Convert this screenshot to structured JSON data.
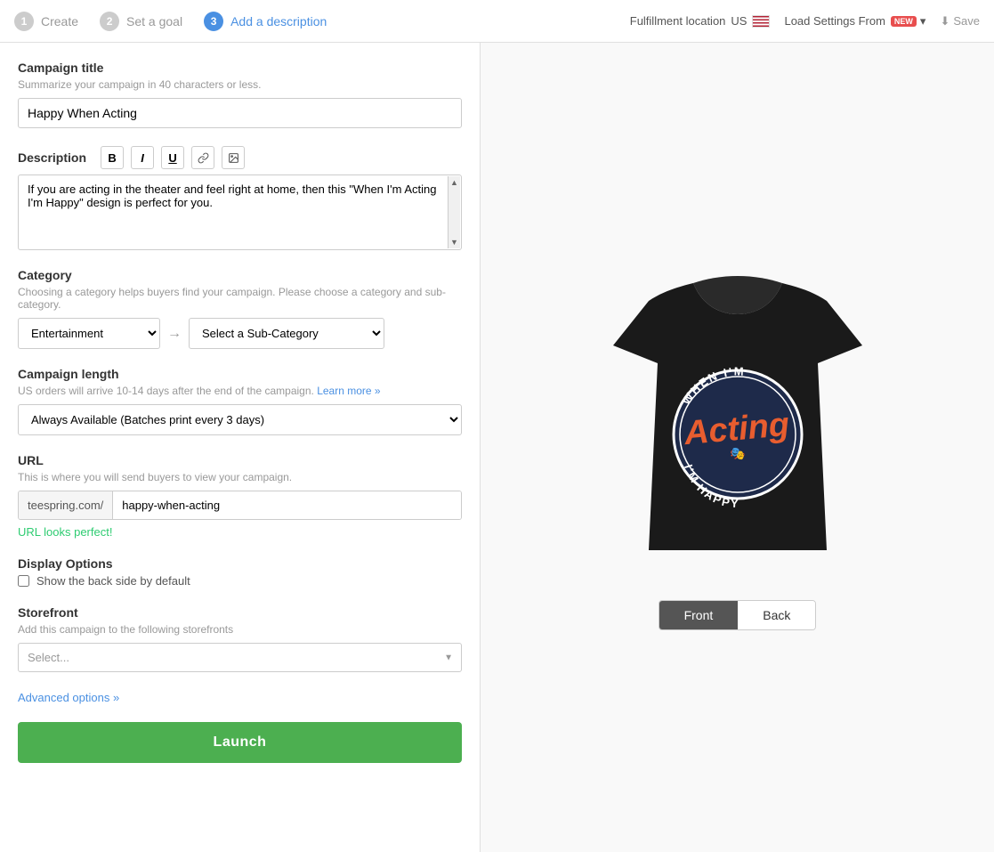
{
  "header": {
    "steps": [
      {
        "num": "1",
        "label": "Create",
        "state": "done"
      },
      {
        "num": "2",
        "label": "Set a goal",
        "state": "done"
      },
      {
        "num": "3",
        "label": "Add a description",
        "state": "active"
      }
    ],
    "fulfillment_label": "Fulfillment location",
    "fulfillment_region": "US",
    "load_settings_label": "Load Settings From",
    "new_badge": "NEW",
    "save_label": "Save"
  },
  "form": {
    "campaign_title_label": "Campaign title",
    "campaign_title_hint": "Summarize your campaign in 40 characters or less.",
    "campaign_title_value": "Happy When Acting",
    "description_label": "Description",
    "description_value": "If you are acting in the theater and feel right at home, then this \"When I'm Acting I'm Happy\" design is perfect for you.",
    "toolbar": {
      "bold": "B",
      "italic": "I",
      "underline": "U"
    },
    "category_label": "Category",
    "category_hint": "Choosing a category helps buyers find your campaign. Please choose a category and sub-category.",
    "category_value": "Entertainment",
    "subcategory_placeholder": "Select a Sub-Category",
    "campaign_length_label": "Campaign length",
    "campaign_length_hint": "US orders will arrive 10-14 days after the end of the campaign.",
    "campaign_length_learn_more": "Learn more »",
    "campaign_length_value": "Always Available (Batches print every 3 days)",
    "url_label": "URL",
    "url_hint": "This is where you will send buyers to view your campaign.",
    "url_prefix": "teespring.com/",
    "url_value": "happy-when-acting",
    "url_status": "URL looks perfect!",
    "display_options_label": "Display Options",
    "show_back_label": "Show the back side by default",
    "storefront_label": "Storefront",
    "storefront_hint": "Add this campaign to the following storefronts",
    "storefront_placeholder": "Select...",
    "advanced_options_label": "Advanced options »",
    "launch_label": "Launch"
  },
  "preview": {
    "front_label": "Front",
    "back_label": "Back"
  }
}
